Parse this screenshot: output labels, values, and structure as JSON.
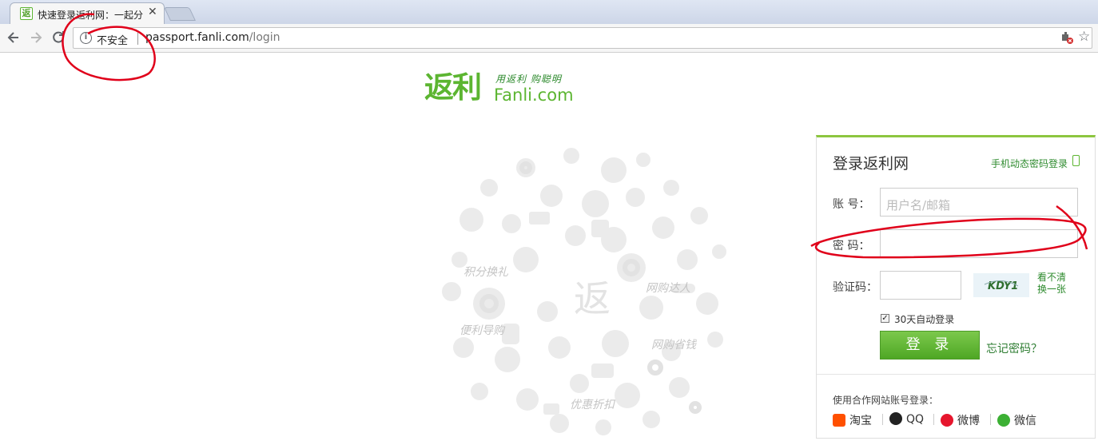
{
  "browser": {
    "tab_title": "快速登录返利网：一起分",
    "tab_favicon": "返",
    "tab_close": "✕",
    "security_label": "不安全",
    "url_host": "passport.fanli.com",
    "url_path": "/login",
    "icons": [
      "back-icon",
      "forward-icon",
      "reload-icon",
      "info-icon",
      "extension-icon",
      "star-icon"
    ]
  },
  "logo": {
    "mark": "返利",
    "slogan": "用返利 购聪明",
    "domain": "Fanli.com"
  },
  "deco": {
    "phrases": [
      "积分换礼",
      "网购达人",
      "便利导购",
      "网购省钱",
      "优惠折扣"
    ],
    "center_glyph": "返"
  },
  "login": {
    "title": "登录返利网",
    "mobile_login": "手机动态密码登录",
    "account_label": "账 号：",
    "account_placeholder": "用户名/邮箱",
    "password_label": "密 码：",
    "captcha_label": "验证码：",
    "captcha_text": "KDY1",
    "captcha_refresh_1": "看不清",
    "captcha_refresh_2": "换一张",
    "remember": "30天自动登录",
    "remember_checked": true,
    "submit": "登 录",
    "forgot": "忘记密码？",
    "partner_title": "使用合作网站账号登录：",
    "partners": [
      {
        "name": "淘宝",
        "icon": "taobao-icon",
        "color": "#ff5000"
      },
      {
        "name": "QQ",
        "icon": "qq-icon",
        "color": "#111111"
      },
      {
        "name": "微博",
        "icon": "weibo-icon",
        "color": "#e6162d"
      },
      {
        "name": "微信",
        "icon": "wechat-icon",
        "color": "#3cb034"
      }
    ]
  },
  "colors": {
    "brand_green": "#5cb531",
    "link_green": "#2e8b2e",
    "annotation_red": "#e0001a"
  }
}
